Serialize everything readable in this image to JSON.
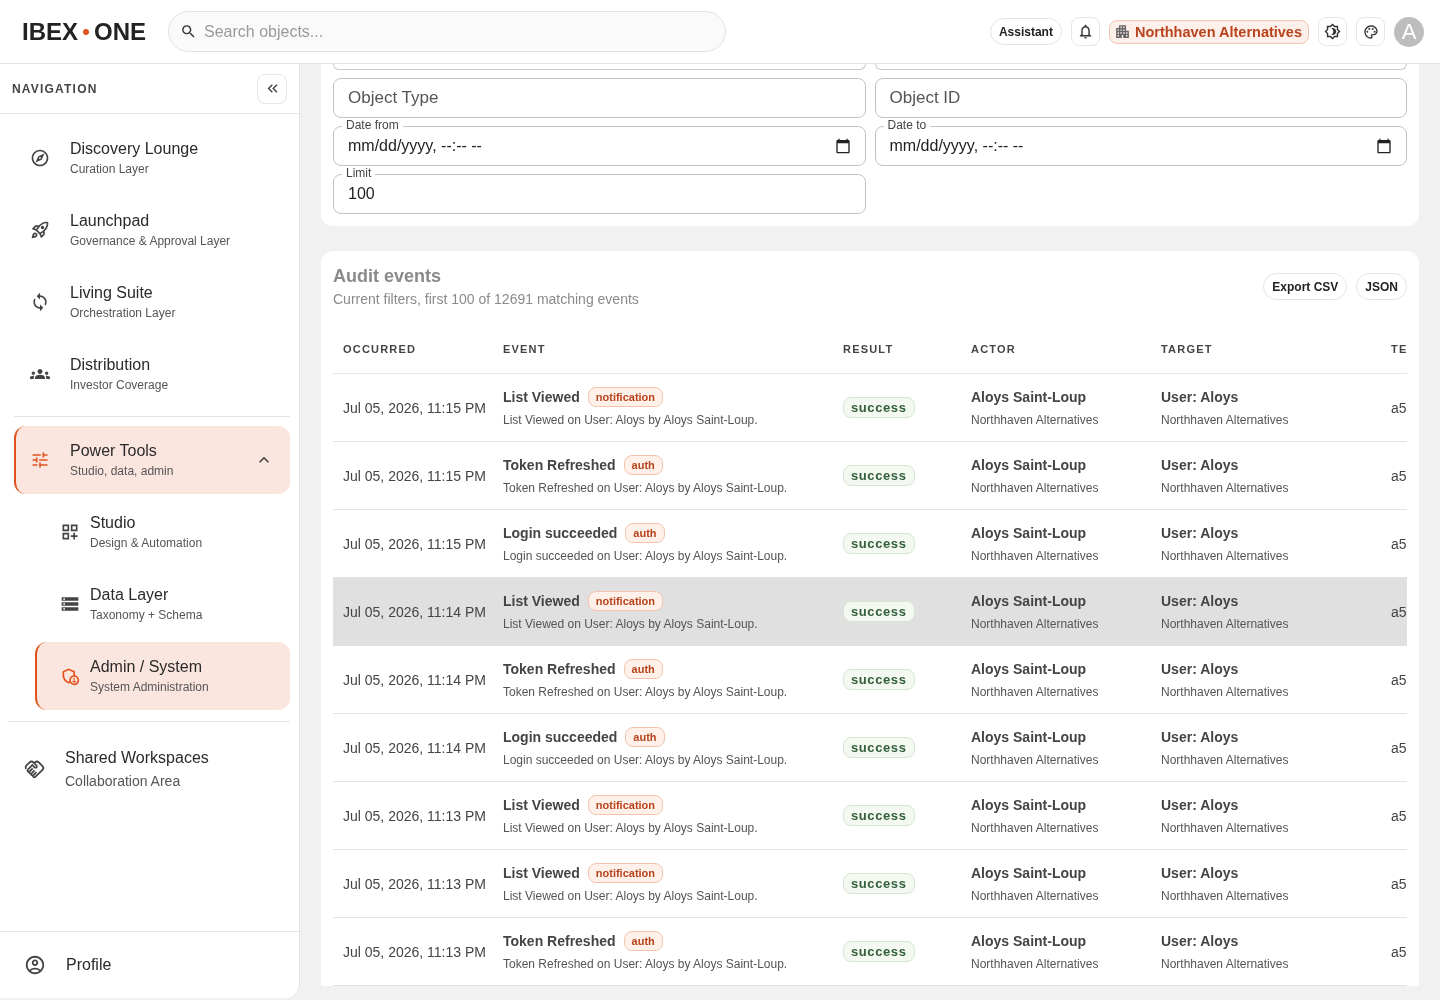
{
  "header": {
    "logo": {
      "left": "IBEX",
      "right": "ONE"
    },
    "search": {
      "placeholder": "Search objects..."
    },
    "assistant_button": "Assistant",
    "organization": "Northhaven Alternatives",
    "avatar_initial": "A"
  },
  "sidebar": {
    "heading": "NAVIGATION",
    "items": [
      {
        "title": "Discovery Lounge",
        "subtitle": "Curation Layer",
        "selected": false
      },
      {
        "title": "Launchpad",
        "subtitle": "Governance & Approval Layer",
        "selected": false
      },
      {
        "title": "Living Suite",
        "subtitle": "Orchestration Layer",
        "selected": false
      },
      {
        "title": "Distribution",
        "subtitle": "Investor Coverage",
        "selected": false
      }
    ],
    "group": {
      "title": "Power Tools",
      "subtitle": "Studio, data, admin",
      "active": true,
      "expanded": true,
      "children": [
        {
          "title": "Studio",
          "subtitle": "Design & Automation",
          "selected": false
        },
        {
          "title": "Data Layer",
          "subtitle": "Taxonomy + Schema",
          "selected": false
        },
        {
          "title": "Admin / System",
          "subtitle": "System Administration",
          "selected": true
        }
      ]
    },
    "extra_items": [
      {
        "title": "Shared Workspaces",
        "subtitle": "Collaboration Area",
        "selected": false
      }
    ],
    "profile": {
      "label": "Profile"
    }
  },
  "filters": {
    "object_type": {
      "placeholder": "Object Type"
    },
    "object_id": {
      "placeholder": "Object ID"
    },
    "date_from": {
      "label": "Date from",
      "value": "mm/dd/yyyy, --:-- --"
    },
    "date_to": {
      "label": "Date to",
      "value": "mm/dd/yyyy, --:-- --"
    },
    "limit": {
      "label": "Limit",
      "value": "100"
    }
  },
  "audit": {
    "title": "Audit events",
    "subtitle": "Current filters, first 100 of 12691 matching events",
    "buttons": [
      "Export CSV",
      "JSON"
    ],
    "columns": [
      "OCCURRED",
      "EVENT",
      "RESULT",
      "ACTOR",
      "TARGET",
      "TE"
    ],
    "rows": [
      {
        "occurred": "Jul 05, 2026, 11:15 PM",
        "event": "List Viewed",
        "tag": "notification",
        "description": "List Viewed on User: Aloys by Aloys Saint-Loup.",
        "result": "success",
        "actor": "Aloys Saint-Loup",
        "actor_org": "Northhaven Alternatives",
        "target": "User: Aloys",
        "target_org": "Northhaven Alternatives",
        "column_6": "a5",
        "highlighted": false
      },
      {
        "occurred": "Jul 05, 2026, 11:15 PM",
        "event": "Token Refreshed",
        "tag": "auth",
        "description": "Token Refreshed on User: Aloys by Aloys Saint-Loup.",
        "result": "success",
        "actor": "Aloys Saint-Loup",
        "actor_org": "Northhaven Alternatives",
        "target": "User: Aloys",
        "target_org": "Northhaven Alternatives",
        "column_6": "a5",
        "highlighted": false
      },
      {
        "occurred": "Jul 05, 2026, 11:15 PM",
        "event": "Login succeeded",
        "tag": "auth",
        "description": "Login succeeded on User: Aloys by Aloys Saint-Loup.",
        "result": "success",
        "actor": "Aloys Saint-Loup",
        "actor_org": "Northhaven Alternatives",
        "target": "User: Aloys",
        "target_org": "Northhaven Alternatives",
        "column_6": "a5",
        "highlighted": false
      },
      {
        "occurred": "Jul 05, 2026, 11:14 PM",
        "event": "List Viewed",
        "tag": "notification",
        "description": "List Viewed on User: Aloys by Aloys Saint-Loup.",
        "result": "success",
        "actor": "Aloys Saint-Loup",
        "actor_org": "Northhaven Alternatives",
        "target": "User: Aloys",
        "target_org": "Northhaven Alternatives",
        "column_6": "a5",
        "highlighted": true
      },
      {
        "occurred": "Jul 05, 2026, 11:14 PM",
        "event": "Token Refreshed",
        "tag": "auth",
        "description": "Token Refreshed on User: Aloys by Aloys Saint-Loup.",
        "result": "success",
        "actor": "Aloys Saint-Loup",
        "actor_org": "Northhaven Alternatives",
        "target": "User: Aloys",
        "target_org": "Northhaven Alternatives",
        "column_6": "a5",
        "highlighted": false
      },
      {
        "occurred": "Jul 05, 2026, 11:14 PM",
        "event": "Login succeeded",
        "tag": "auth",
        "description": "Login succeeded on User: Aloys by Aloys Saint-Loup.",
        "result": "success",
        "actor": "Aloys Saint-Loup",
        "actor_org": "Northhaven Alternatives",
        "target": "User: Aloys",
        "target_org": "Northhaven Alternatives",
        "column_6": "a5",
        "highlighted": false
      },
      {
        "occurred": "Jul 05, 2026, 11:13 PM",
        "event": "List Viewed",
        "tag": "notification",
        "description": "List Viewed on User: Aloys by Aloys Saint-Loup.",
        "result": "success",
        "actor": "Aloys Saint-Loup",
        "actor_org": "Northhaven Alternatives",
        "target": "User: Aloys",
        "target_org": "Northhaven Alternatives",
        "column_6": "a5",
        "highlighted": false
      },
      {
        "occurred": "Jul 05, 2026, 11:13 PM",
        "event": "List Viewed",
        "tag": "notification",
        "description": "List Viewed on User: Aloys by Aloys Saint-Loup.",
        "result": "success",
        "actor": "Aloys Saint-Loup",
        "actor_org": "Northhaven Alternatives",
        "target": "User: Aloys",
        "target_org": "Northhaven Alternatives",
        "column_6": "a5",
        "highlighted": false
      },
      {
        "occurred": "Jul 05, 2026, 11:13 PM",
        "event": "Token Refreshed",
        "tag": "auth",
        "description": "Token Refreshed on User: Aloys by Aloys Saint-Loup.",
        "result": "success",
        "actor": "Aloys Saint-Loup",
        "actor_org": "Northhaven Alternatives",
        "target": "User: Aloys",
        "target_org": "Northhaven Alternatives",
        "column_6": "a5",
        "highlighted": false
      }
    ]
  }
}
